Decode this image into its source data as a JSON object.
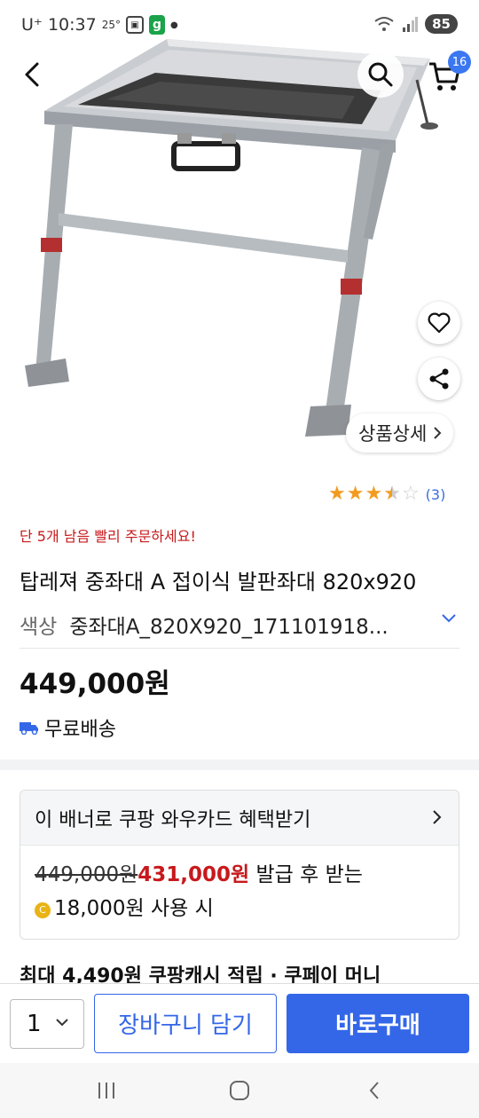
{
  "status_bar": {
    "carrier": "U⁺",
    "time": "10:37",
    "temperature": "25°",
    "battery": "85"
  },
  "header": {
    "cart_count": "16"
  },
  "image_overlay": {
    "detail_label": "상품상세"
  },
  "rating": {
    "stars": 3.5,
    "max": 5,
    "review_count": "(3)"
  },
  "product": {
    "urgency": "단 5개 남음 빨리 주문하세요!",
    "title": "탑레져 중좌대 A 접이식 발판좌대 820x920",
    "option_label": "색상",
    "option_value": "중좌대A_820X920_171101918...",
    "price": "449,000원",
    "shipping": "무료배송"
  },
  "banner": {
    "heading": "이 배너로 쿠팡 와우카드 혜택받기",
    "original_price": "449,000원",
    "discounted_price": "431,000원",
    "after_text": "발급 후 받는",
    "coin_symbol": "C",
    "cash_amount": "18,000원 사용 시"
  },
  "cashback_line": "최대 4,490원 쿠팡캐시 적립 · 쿠페이 머니",
  "bottom_bar": {
    "quantity": "1",
    "add_to_cart": "장바구니 담기",
    "buy_now": "바로구매"
  },
  "colors": {
    "accent_blue": "#3467e8",
    "urgent_red": "#c8191c",
    "star": "#f29b1f"
  }
}
